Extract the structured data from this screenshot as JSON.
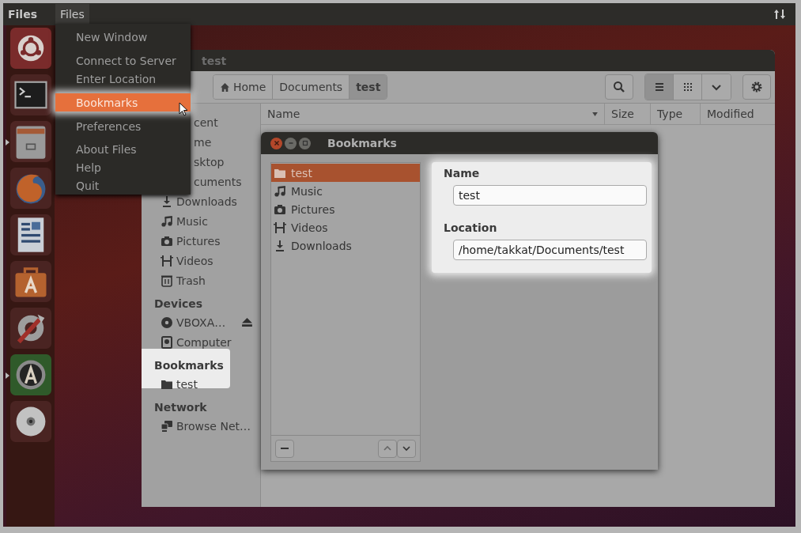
{
  "top_bar": {
    "app_name": "Files",
    "menu_title": "Files",
    "menu_open": true
  },
  "launcher": [
    {
      "kind": "ubuntu"
    },
    {
      "kind": "terminal"
    },
    {
      "kind": "cabinet",
      "running": true
    },
    {
      "kind": "browser"
    },
    {
      "kind": "document"
    },
    {
      "kind": "bag"
    },
    {
      "kind": "tools"
    },
    {
      "kind": "update",
      "running": true
    },
    {
      "kind": "disc"
    }
  ],
  "app_menu": [
    {
      "label": "New Window",
      "selected": false
    },
    {
      "label": "Connect to Server",
      "selected": false
    },
    {
      "label": "Enter Location",
      "selected": false
    },
    {
      "label": "Bookmarks",
      "selected": true
    },
    {
      "label": "Preferences",
      "selected": false
    },
    {
      "label": "About Files",
      "selected": false
    },
    {
      "label": "Help",
      "selected": false
    },
    {
      "label": "Quit",
      "selected": false
    }
  ],
  "files_window": {
    "title": "test",
    "path": [
      {
        "label": "Home",
        "kind": "home",
        "selected": false
      },
      {
        "label": "Documents",
        "kind": "plain",
        "selected": false
      },
      {
        "label": "test",
        "kind": "plain",
        "selected": true
      }
    ],
    "views": [
      {
        "kind": "list",
        "selected": true
      },
      {
        "kind": "grid",
        "selected": false
      },
      {
        "kind": "more",
        "selected": false
      }
    ],
    "columns": [
      {
        "label": "Name",
        "sorted": true
      },
      {
        "label": "Size",
        "sorted": false
      },
      {
        "label": "Type",
        "sorted": false
      },
      {
        "label": "Modified",
        "sorted": false
      }
    ],
    "sidebar": [
      {
        "items": [
          {
            "label": "cent",
            "kind": "clipped"
          },
          {
            "label": "me",
            "kind": "clipped"
          },
          {
            "label": "sktop",
            "kind": "clipped"
          },
          {
            "label": "cuments",
            "kind": "clipped"
          },
          {
            "label": "Downloads",
            "kind": "download"
          },
          {
            "label": "Music",
            "kind": "music"
          },
          {
            "label": "Pictures",
            "kind": "camera"
          },
          {
            "label": "Videos",
            "kind": "film"
          },
          {
            "label": "Trash",
            "kind": "trash"
          }
        ]
      },
      {
        "heading": "Devices",
        "items": [
          {
            "label": "VBOXA…",
            "kind": "disc",
            "eject": true
          },
          {
            "label": "Computer",
            "kind": "drive"
          }
        ]
      },
      {
        "heading": "Bookmarks",
        "highlight": true,
        "items": [
          {
            "label": "test",
            "kind": "folder"
          }
        ]
      },
      {
        "heading": "Network",
        "items": [
          {
            "label": "Browse Net…",
            "kind": "network"
          }
        ]
      }
    ]
  },
  "bookmarks_dialog": {
    "title": "Bookmarks",
    "items": [
      {
        "label": "test",
        "kind": "folder",
        "selected": true
      },
      {
        "label": "Music",
        "kind": "music",
        "selected": false
      },
      {
        "label": "Pictures",
        "kind": "camera",
        "selected": false
      },
      {
        "label": "Videos",
        "kind": "film",
        "selected": false
      },
      {
        "label": "Downloads",
        "kind": "download",
        "selected": false
      }
    ],
    "name_label": "Name",
    "name_value": "test",
    "location_label": "Location",
    "location_value": "/home/takkat/Documents/test"
  }
}
